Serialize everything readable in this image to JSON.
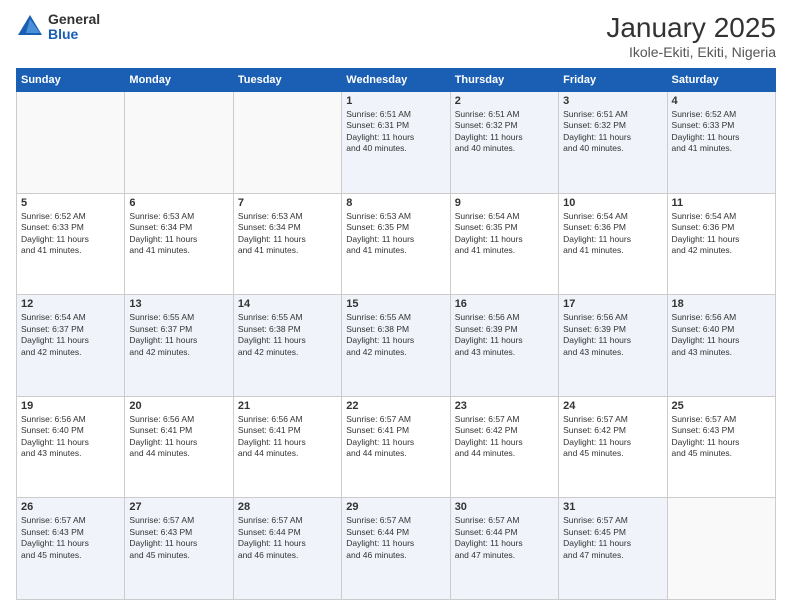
{
  "header": {
    "logo_general": "General",
    "logo_blue": "Blue",
    "month_title": "January 2025",
    "location": "Ikole-Ekiti, Ekiti, Nigeria"
  },
  "weekdays": [
    "Sunday",
    "Monday",
    "Tuesday",
    "Wednesday",
    "Thursday",
    "Friday",
    "Saturday"
  ],
  "weeks": [
    [
      {
        "day": "",
        "info": ""
      },
      {
        "day": "",
        "info": ""
      },
      {
        "day": "",
        "info": ""
      },
      {
        "day": "1",
        "info": "Sunrise: 6:51 AM\nSunset: 6:31 PM\nDaylight: 11 hours\nand 40 minutes."
      },
      {
        "day": "2",
        "info": "Sunrise: 6:51 AM\nSunset: 6:32 PM\nDaylight: 11 hours\nand 40 minutes."
      },
      {
        "day": "3",
        "info": "Sunrise: 6:51 AM\nSunset: 6:32 PM\nDaylight: 11 hours\nand 40 minutes."
      },
      {
        "day": "4",
        "info": "Sunrise: 6:52 AM\nSunset: 6:33 PM\nDaylight: 11 hours\nand 41 minutes."
      }
    ],
    [
      {
        "day": "5",
        "info": "Sunrise: 6:52 AM\nSunset: 6:33 PM\nDaylight: 11 hours\nand 41 minutes."
      },
      {
        "day": "6",
        "info": "Sunrise: 6:53 AM\nSunset: 6:34 PM\nDaylight: 11 hours\nand 41 minutes."
      },
      {
        "day": "7",
        "info": "Sunrise: 6:53 AM\nSunset: 6:34 PM\nDaylight: 11 hours\nand 41 minutes."
      },
      {
        "day": "8",
        "info": "Sunrise: 6:53 AM\nSunset: 6:35 PM\nDaylight: 11 hours\nand 41 minutes."
      },
      {
        "day": "9",
        "info": "Sunrise: 6:54 AM\nSunset: 6:35 PM\nDaylight: 11 hours\nand 41 minutes."
      },
      {
        "day": "10",
        "info": "Sunrise: 6:54 AM\nSunset: 6:36 PM\nDaylight: 11 hours\nand 41 minutes."
      },
      {
        "day": "11",
        "info": "Sunrise: 6:54 AM\nSunset: 6:36 PM\nDaylight: 11 hours\nand 42 minutes."
      }
    ],
    [
      {
        "day": "12",
        "info": "Sunrise: 6:54 AM\nSunset: 6:37 PM\nDaylight: 11 hours\nand 42 minutes."
      },
      {
        "day": "13",
        "info": "Sunrise: 6:55 AM\nSunset: 6:37 PM\nDaylight: 11 hours\nand 42 minutes."
      },
      {
        "day": "14",
        "info": "Sunrise: 6:55 AM\nSunset: 6:38 PM\nDaylight: 11 hours\nand 42 minutes."
      },
      {
        "day": "15",
        "info": "Sunrise: 6:55 AM\nSunset: 6:38 PM\nDaylight: 11 hours\nand 42 minutes."
      },
      {
        "day": "16",
        "info": "Sunrise: 6:56 AM\nSunset: 6:39 PM\nDaylight: 11 hours\nand 43 minutes."
      },
      {
        "day": "17",
        "info": "Sunrise: 6:56 AM\nSunset: 6:39 PM\nDaylight: 11 hours\nand 43 minutes."
      },
      {
        "day": "18",
        "info": "Sunrise: 6:56 AM\nSunset: 6:40 PM\nDaylight: 11 hours\nand 43 minutes."
      }
    ],
    [
      {
        "day": "19",
        "info": "Sunrise: 6:56 AM\nSunset: 6:40 PM\nDaylight: 11 hours\nand 43 minutes."
      },
      {
        "day": "20",
        "info": "Sunrise: 6:56 AM\nSunset: 6:41 PM\nDaylight: 11 hours\nand 44 minutes."
      },
      {
        "day": "21",
        "info": "Sunrise: 6:56 AM\nSunset: 6:41 PM\nDaylight: 11 hours\nand 44 minutes."
      },
      {
        "day": "22",
        "info": "Sunrise: 6:57 AM\nSunset: 6:41 PM\nDaylight: 11 hours\nand 44 minutes."
      },
      {
        "day": "23",
        "info": "Sunrise: 6:57 AM\nSunset: 6:42 PM\nDaylight: 11 hours\nand 44 minutes."
      },
      {
        "day": "24",
        "info": "Sunrise: 6:57 AM\nSunset: 6:42 PM\nDaylight: 11 hours\nand 45 minutes."
      },
      {
        "day": "25",
        "info": "Sunrise: 6:57 AM\nSunset: 6:43 PM\nDaylight: 11 hours\nand 45 minutes."
      }
    ],
    [
      {
        "day": "26",
        "info": "Sunrise: 6:57 AM\nSunset: 6:43 PM\nDaylight: 11 hours\nand 45 minutes."
      },
      {
        "day": "27",
        "info": "Sunrise: 6:57 AM\nSunset: 6:43 PM\nDaylight: 11 hours\nand 45 minutes."
      },
      {
        "day": "28",
        "info": "Sunrise: 6:57 AM\nSunset: 6:44 PM\nDaylight: 11 hours\nand 46 minutes."
      },
      {
        "day": "29",
        "info": "Sunrise: 6:57 AM\nSunset: 6:44 PM\nDaylight: 11 hours\nand 46 minutes."
      },
      {
        "day": "30",
        "info": "Sunrise: 6:57 AM\nSunset: 6:44 PM\nDaylight: 11 hours\nand 47 minutes."
      },
      {
        "day": "31",
        "info": "Sunrise: 6:57 AM\nSunset: 6:45 PM\nDaylight: 11 hours\nand 47 minutes."
      },
      {
        "day": "",
        "info": ""
      }
    ]
  ]
}
